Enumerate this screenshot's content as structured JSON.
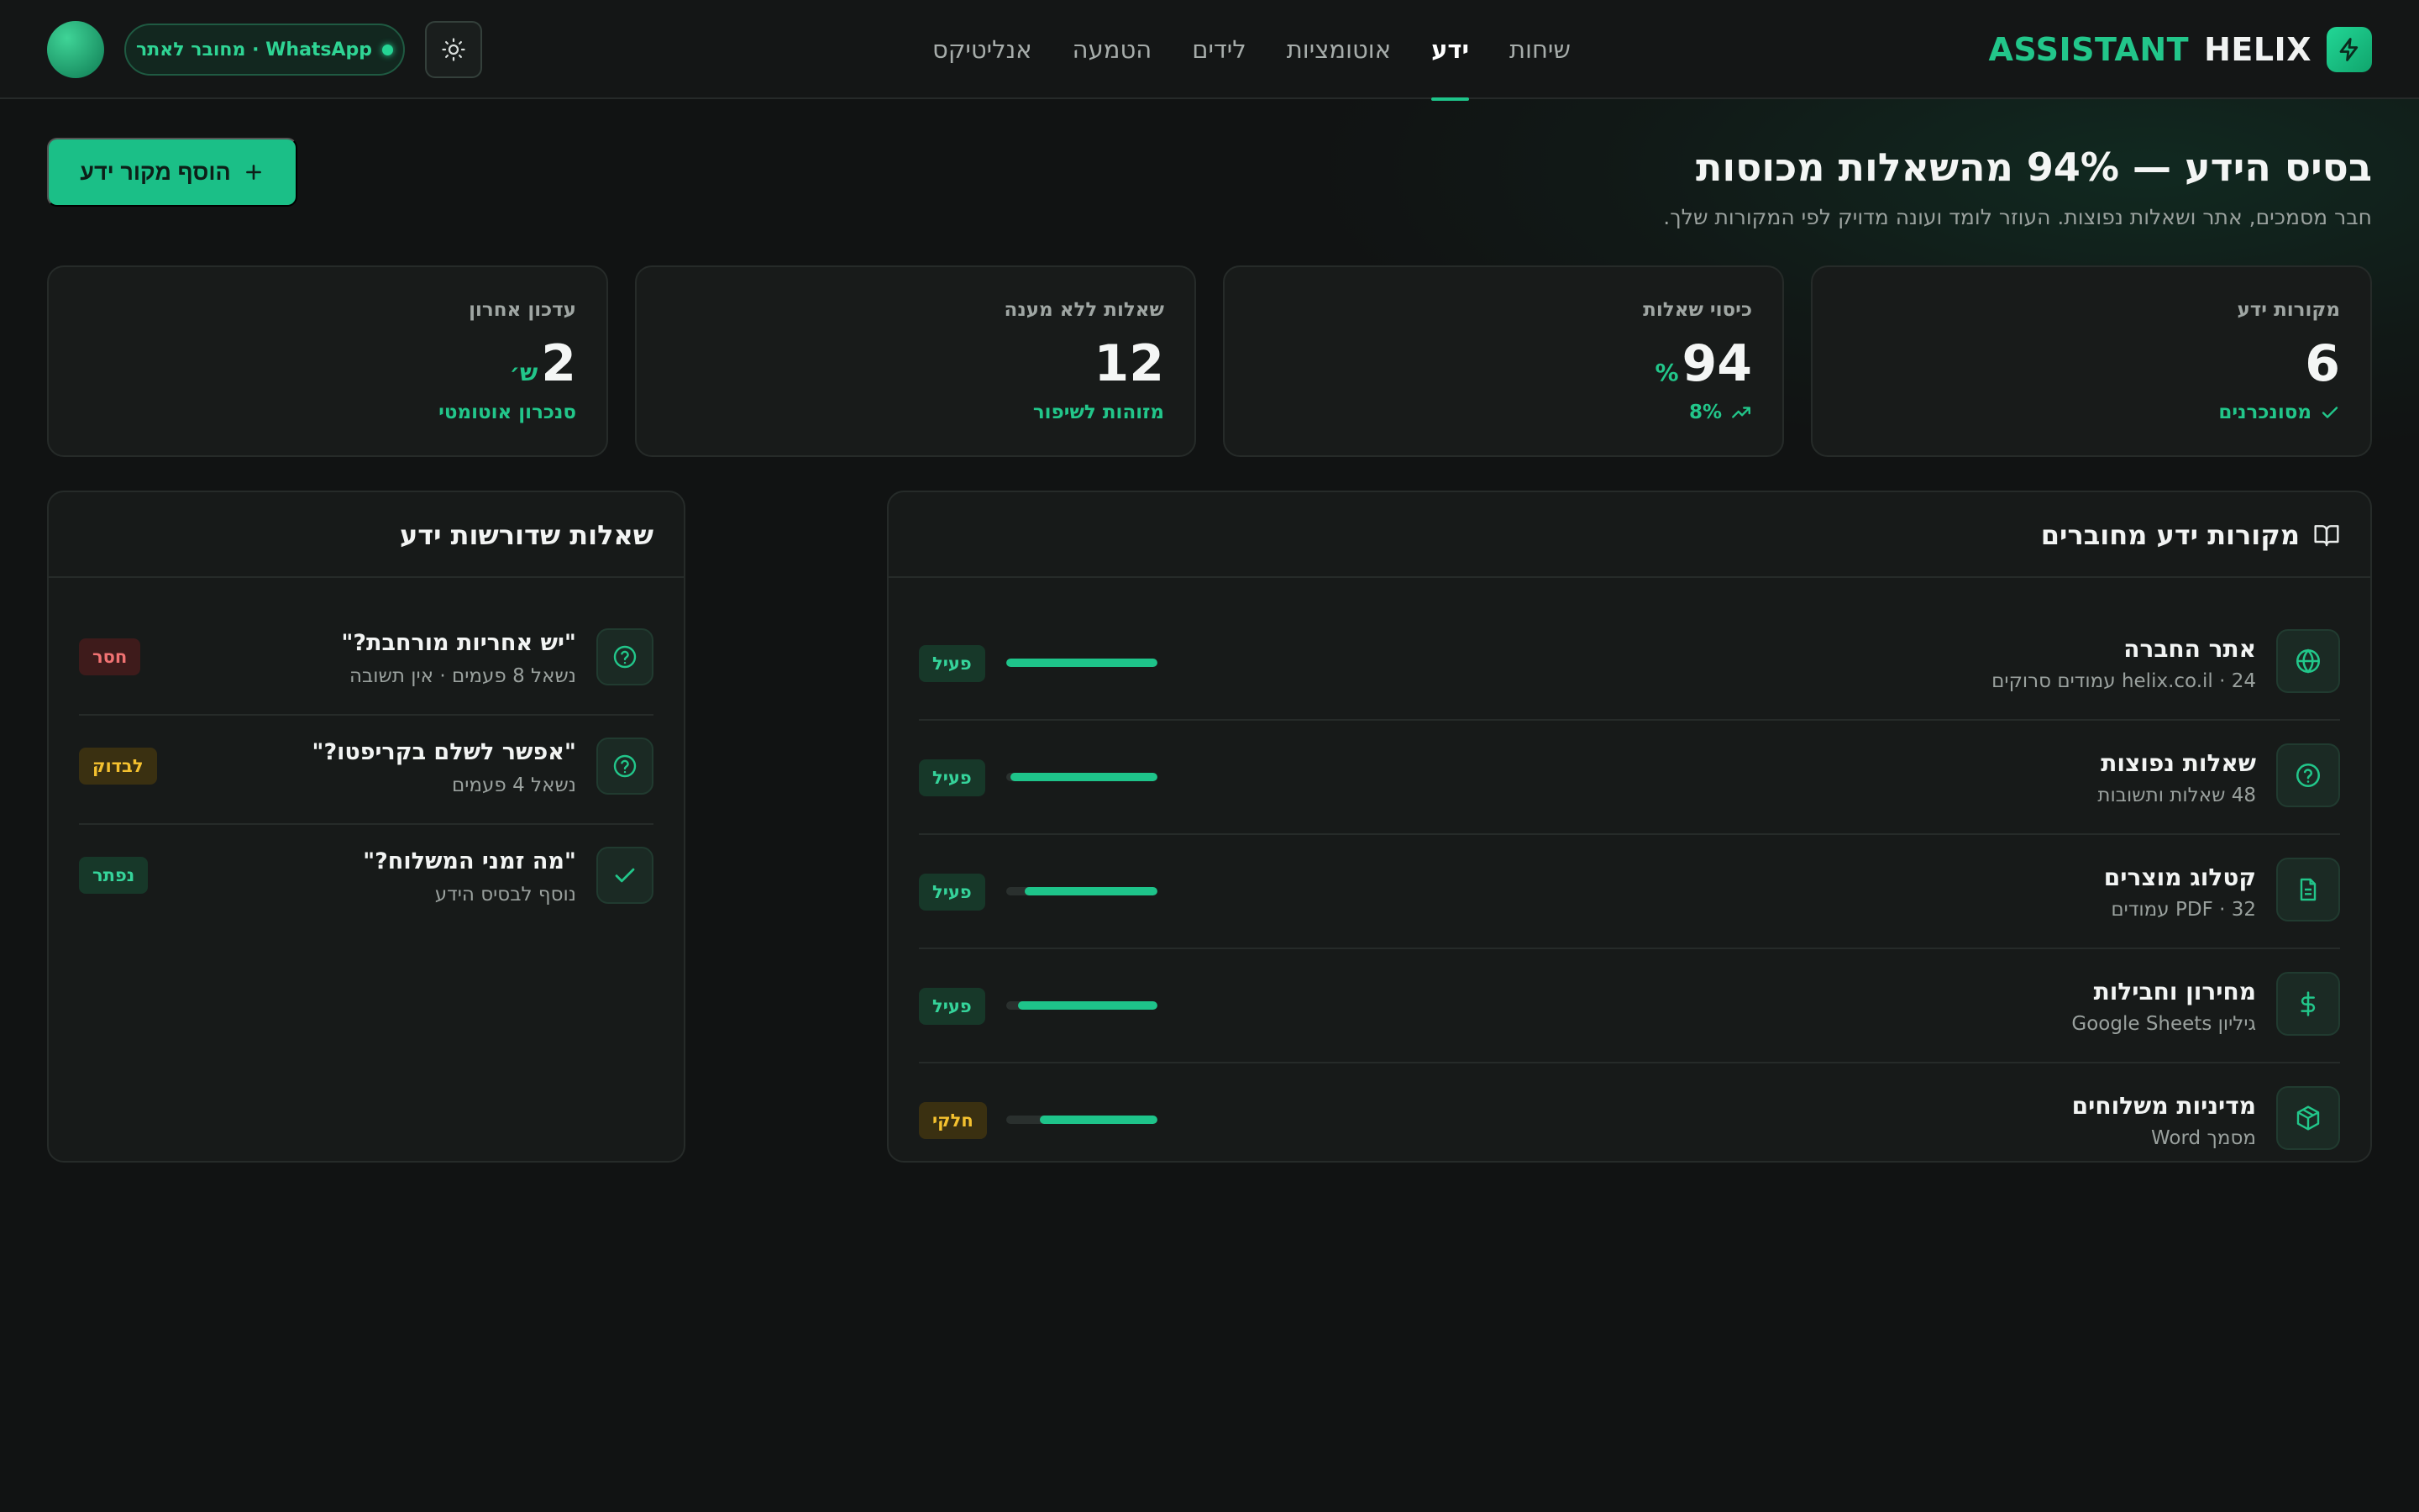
{
  "brand": {
    "assistant": "ASSISTANT",
    "helix": "HELIX"
  },
  "nav": [
    {
      "label": "שיחות",
      "active": false
    },
    {
      "label": "ידע",
      "active": true
    },
    {
      "label": "אוטומציות",
      "active": false
    },
    {
      "label": "לידים",
      "active": false
    },
    {
      "label": "הטמעה",
      "active": false
    },
    {
      "label": "אנליטיקס",
      "active": false
    }
  ],
  "status": {
    "whatsapp": "WhatsApp · מחובר לאתר"
  },
  "page": {
    "title": "בסיס הידע — 94% מהשאלות מכוסות",
    "subtitle": "חבר מסמכים, אתר ושאלות נפוצות. העוזר לומד ועונה מדויק לפי המקורות שלך.",
    "add_button": "הוסף מקור ידע"
  },
  "stats": [
    {
      "label": "מקורות ידע",
      "value": "6",
      "unit": "",
      "foot": "מסונכרנים",
      "foot_icon": "check-icon"
    },
    {
      "label": "כיסוי שאלות",
      "value": "94",
      "unit": "%",
      "foot": "8%",
      "foot_icon": "trending-up-icon"
    },
    {
      "label": "שאלות ללא מענה",
      "value": "12",
      "unit": "",
      "foot": "מזוהות לשיפור",
      "foot_icon": ""
    },
    {
      "label": "עדכון אחרון",
      "value": "2",
      "unit": "ש׳",
      "foot": "סנכרון אוטומטי",
      "foot_icon": ""
    }
  ],
  "sources_panel": {
    "title": "מקורות ידע מחוברים",
    "items": [
      {
        "name": "אתר החברה",
        "meta": "helix.co.il · 24 עמודים סרוקים",
        "icon": "globe-icon",
        "progress": 1.0,
        "status": "פעיל",
        "status_kind": "ok"
      },
      {
        "name": "שאלות נפוצות",
        "meta": "48 שאלות ותשובות",
        "icon": "question-icon",
        "progress": 0.97,
        "status": "פעיל",
        "status_kind": "ok"
      },
      {
        "name": "קטלוג מוצרים",
        "meta": "PDF · 32 עמודים",
        "icon": "file-icon",
        "progress": 0.88,
        "status": "פעיל",
        "status_kind": "ok"
      },
      {
        "name": "מחירון וחבילות",
        "meta": "גיליון Google Sheets",
        "icon": "dollar-icon",
        "progress": 0.92,
        "status": "פעיל",
        "status_kind": "ok"
      },
      {
        "name": "מדיניות משלוחים",
        "meta": "מסמך Word",
        "icon": "box-icon",
        "progress": 0.78,
        "status": "חלקי",
        "status_kind": "warn"
      }
    ]
  },
  "questions_panel": {
    "title": "שאלות שדורשות ידע",
    "items": [
      {
        "title": "\"יש אחריות מורחבת?\"",
        "meta": "נשאל 8 פעמים · אין תשובה",
        "icon": "question-icon",
        "status": "חסר",
        "status_kind": "bad"
      },
      {
        "title": "\"אפשר לשלם בקריפטו?\"",
        "meta": "נשאל 4 פעמים",
        "icon": "question-icon",
        "status": "לבדוק",
        "status_kind": "warn"
      },
      {
        "title": "\"מה זמני המשלוח?\"",
        "meta": "נוסף לבסיס הידע",
        "icon": "check-icon",
        "status": "נפתר",
        "status_kind": "ok"
      }
    ]
  }
}
